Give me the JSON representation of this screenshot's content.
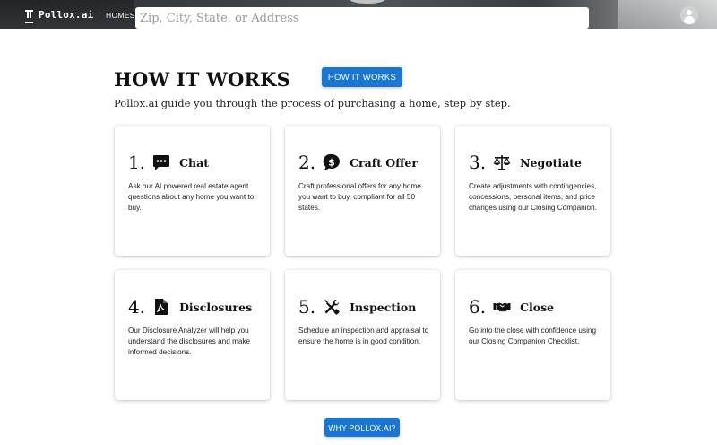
{
  "header": {
    "brand": "Pollox.ai",
    "nav_homes": "HOMES",
    "search_placeholder": "Zip, City, State, or Address"
  },
  "section": {
    "title": "HOW IT WORKS",
    "subtitle": "Pollox.ai guide you through the process of purchasing a home, step by step.",
    "how_button": "HOW IT WORKS",
    "why_button": "WHY POLLOX.AI?"
  },
  "steps": [
    {
      "number": "1.",
      "icon": "chat-icon",
      "title": "Chat",
      "description": "Ask our AI powered real estate agent questions about any home you want to buy."
    },
    {
      "number": "2.",
      "icon": "dollar-icon",
      "title": "Craft Offer",
      "description": "Craft professional offers for any home you want to buy, compliant for all 50 states."
    },
    {
      "number": "3.",
      "icon": "scale-icon",
      "title": "Negotiate",
      "description": "Create adjustments with contingencies, concessions, personal items, and price changes using our Closing Companion."
    },
    {
      "number": "4.",
      "icon": "document-icon",
      "title": "Disclosures",
      "description": "Our Disclosure Analyzer will help you understand the disclosures and make informed decisions."
    },
    {
      "number": "5.",
      "icon": "tools-icon",
      "title": "Inspection",
      "description": "Schedule an inspection and appraisal to ensure the home is in good condition."
    },
    {
      "number": "6.",
      "icon": "handshake-icon",
      "title": "Close",
      "description": "Go into the close with confidence using our Closing Companion Checklist."
    }
  ],
  "colors": {
    "accent": "#1976d2",
    "text": "#111111"
  }
}
